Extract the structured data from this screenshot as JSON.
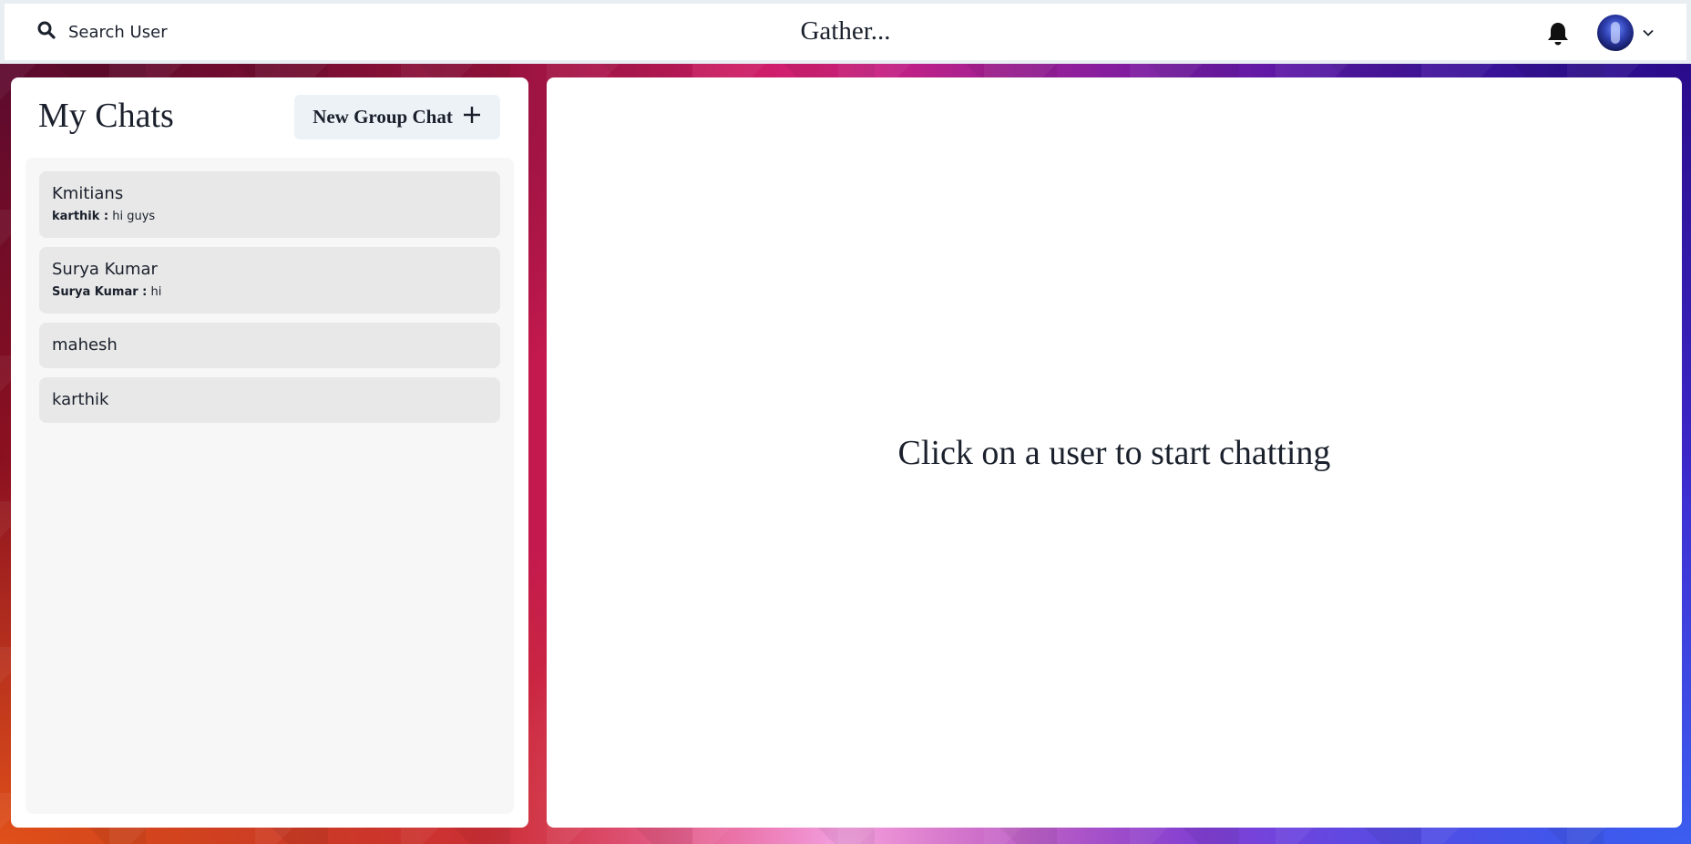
{
  "header": {
    "search_label": "Search User",
    "brand": "Gather...",
    "icons": [
      "search-icon",
      "bell-icon",
      "avatar",
      "chevron-down-icon"
    ]
  },
  "sidebar": {
    "title": "My Chats",
    "new_group_label": "New Group Chat",
    "chats": [
      {
        "name": "Kmitians",
        "last_sender": "karthik :",
        "last_message": "hi guys"
      },
      {
        "name": "Surya Kumar",
        "last_sender": "Surya Kumar :",
        "last_message": "hi"
      },
      {
        "name": "mahesh"
      },
      {
        "name": "karthik"
      }
    ]
  },
  "main": {
    "empty_message": "Click on a user to start chatting"
  },
  "colors": {
    "panel": "#ffffff",
    "chat_item": "#e8e8e8",
    "list_bg": "#f7f7f7",
    "button_bg": "#edf2f7",
    "text": "#1a202c"
  }
}
